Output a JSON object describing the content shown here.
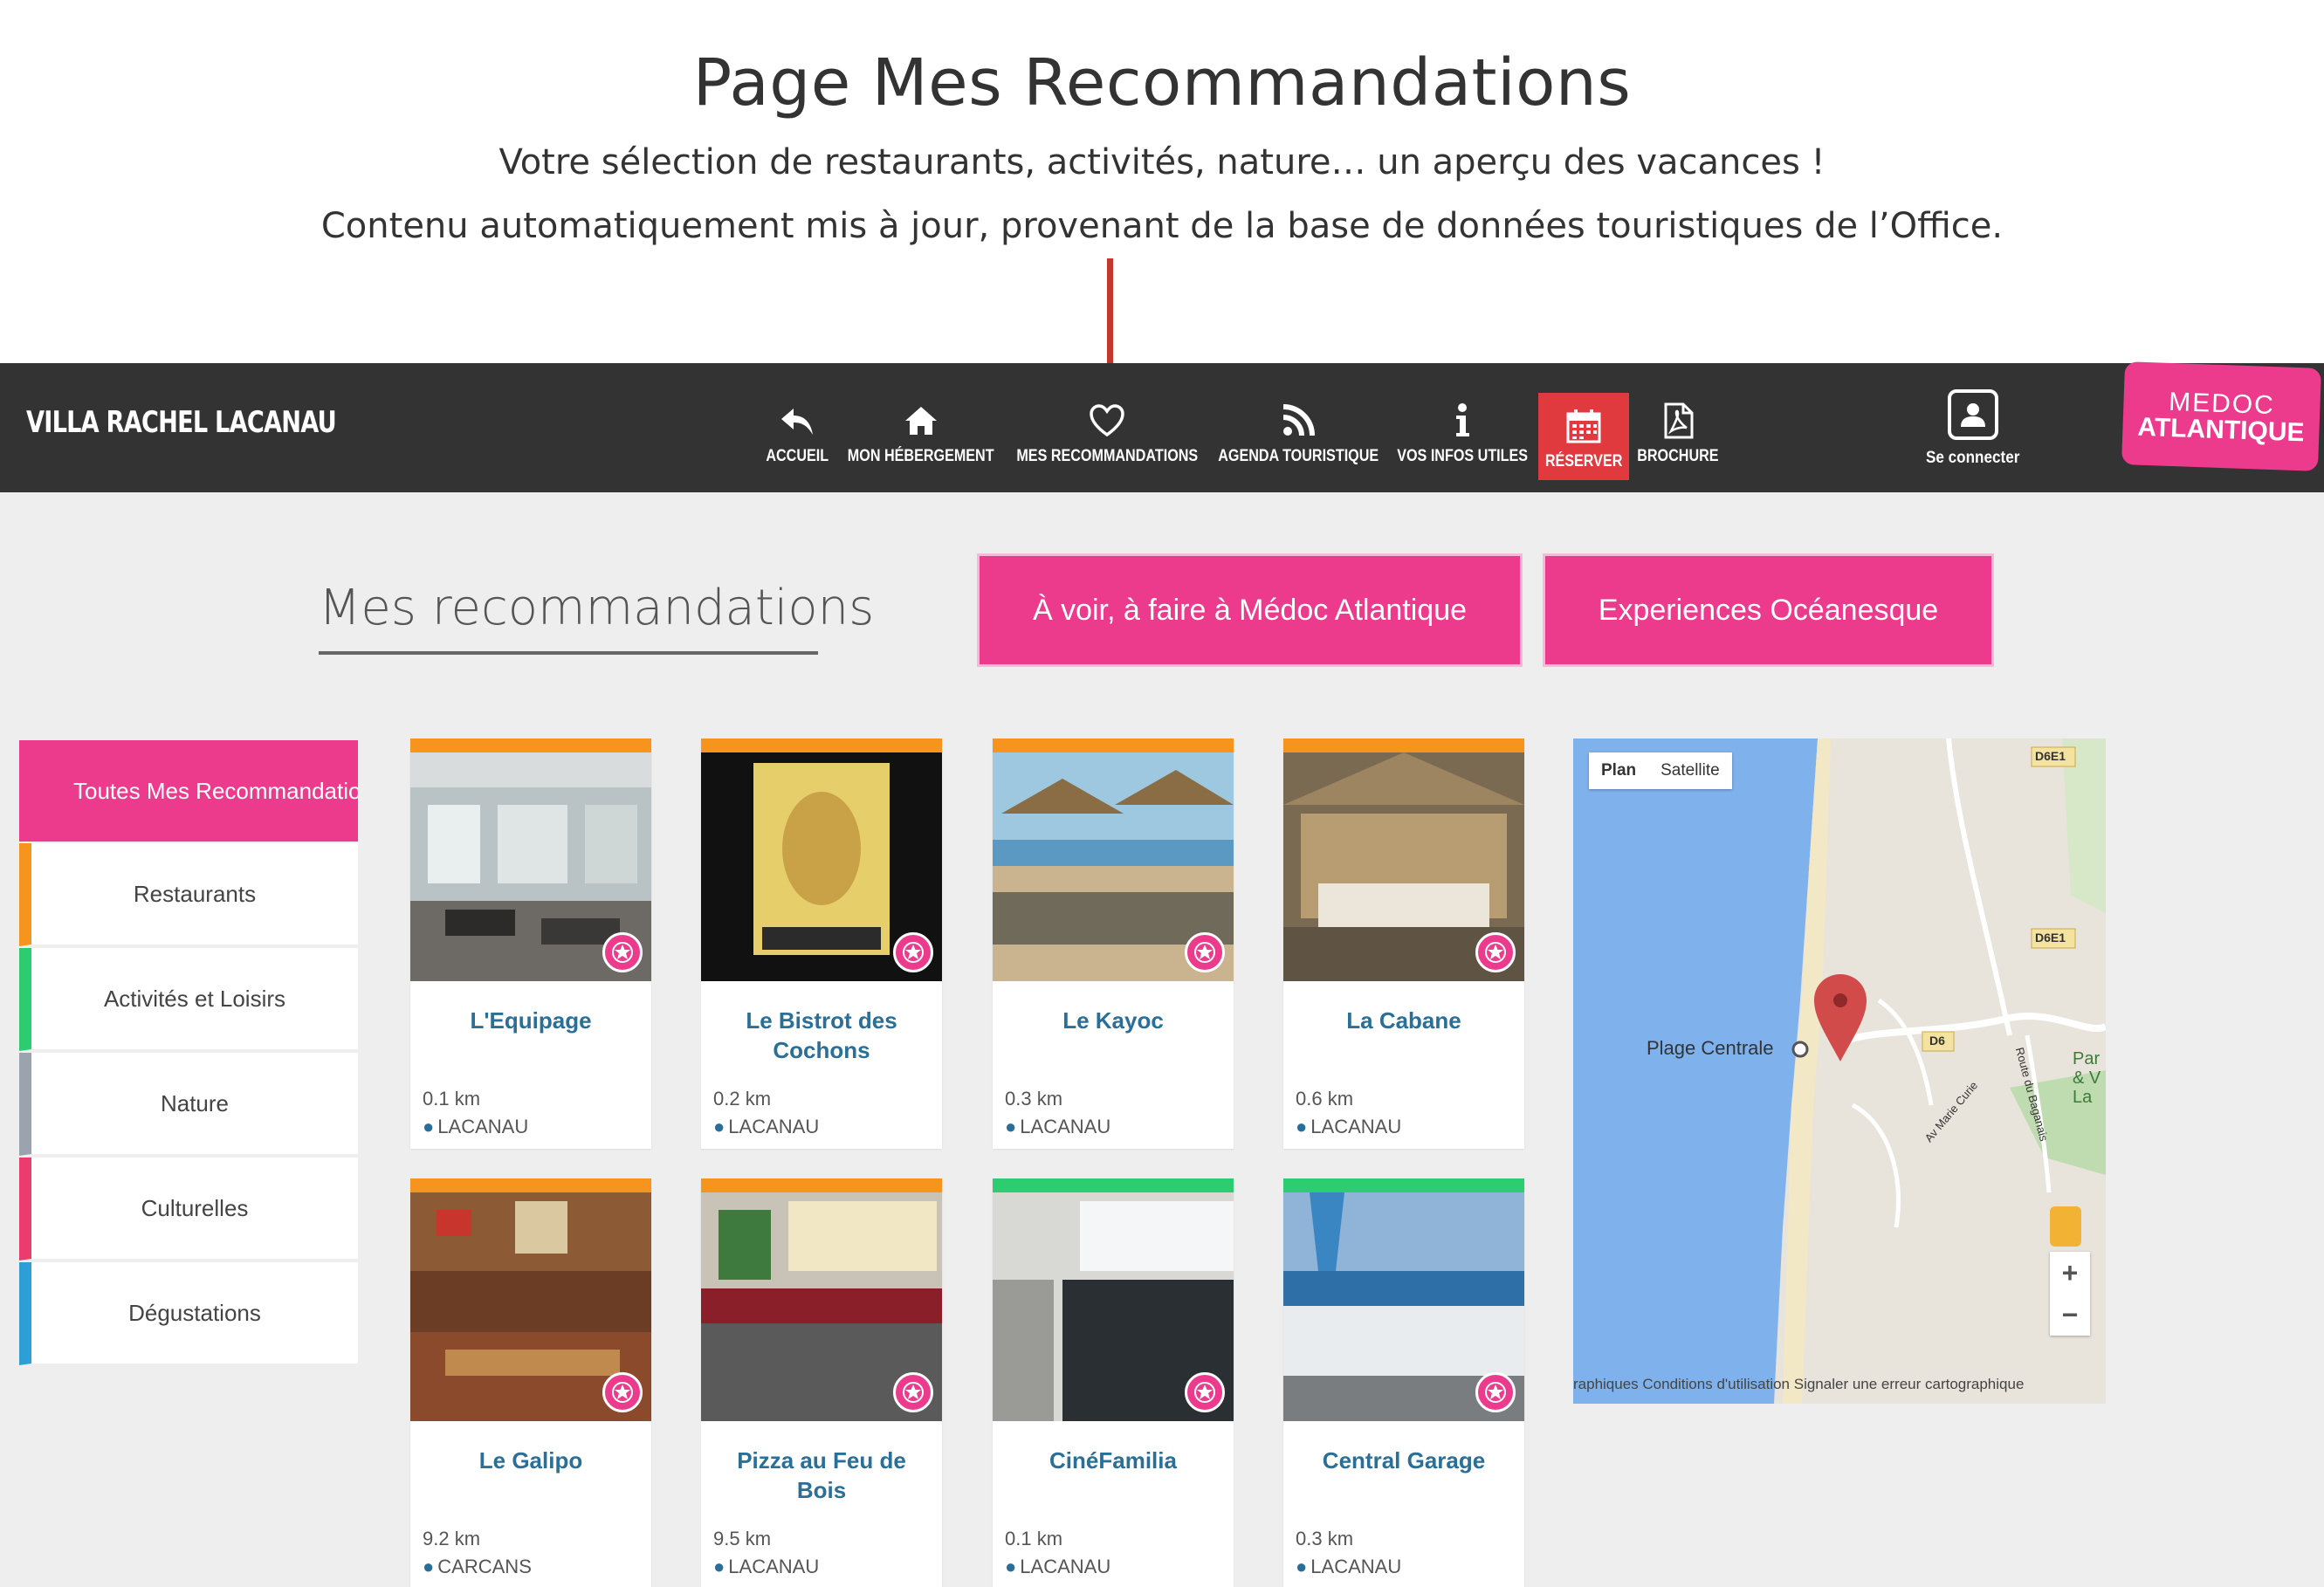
{
  "annotation": {
    "title": "Page Mes Recommandations",
    "line1": "Votre sélection de restaurants, activités, nature… un aperçu des vacances !",
    "line2": "Contenu automatiquement mis à jour, provenant de la base de données touristiques de l’Office."
  },
  "navbar": {
    "brand": "VILLA RACHEL LACANAU",
    "items": [
      {
        "label": "ACCUEIL",
        "icon": "reply-icon"
      },
      {
        "label": "MON HÉBERGEMENT",
        "icon": "home-icon"
      },
      {
        "label": "MES RECOMMANDATIONS",
        "icon": "heart-icon"
      },
      {
        "label": "AGENDA TOURISTIQUE",
        "icon": "rss-icon"
      },
      {
        "label": "VOS INFOS UTILES",
        "icon": "info-icon"
      },
      {
        "label": "RÉSERVER",
        "icon": "calendar-icon"
      },
      {
        "label": "BROCHURE",
        "icon": "pdf-icon"
      }
    ],
    "login": "Se connecter",
    "logo_line1": "MEDOC",
    "logo_line2": "ATLANTIQUE",
    "reserve_color": "#e03a3e"
  },
  "main": {
    "heading": "Mes recommandations",
    "button1": "À voir, à faire à Médoc Atlantique",
    "button2": "Experiences Océanesque",
    "accent": "#ec3b8d"
  },
  "filters": {
    "active": "Toutes Mes Recommandations",
    "items": [
      {
        "label": "Restaurants",
        "color": "#f7941d"
      },
      {
        "label": "Activités et Loisirs",
        "color": "#2ecc71"
      },
      {
        "label": "Nature",
        "color": "#9ba3ae"
      },
      {
        "label": "Culturelles",
        "color": "#ec3b6d"
      },
      {
        "label": "Dégustations",
        "color": "#2e9fd6"
      }
    ]
  },
  "cards": [
    {
      "name": "L'Equipage",
      "dist": "0.1 km",
      "town": "LACANAU",
      "color": "#f7941d"
    },
    {
      "name": "Le Bistrot des Cochons",
      "dist": "0.2 km",
      "town": "LACANAU",
      "color": "#f7941d"
    },
    {
      "name": "Le Kayoc",
      "dist": "0.3 km",
      "town": "LACANAU",
      "color": "#f7941d"
    },
    {
      "name": "La Cabane",
      "dist": "0.6 km",
      "town": "LACANAU",
      "color": "#f7941d"
    },
    {
      "name": "Le Galipo",
      "dist": "9.2 km",
      "town": "CARCANS",
      "color": "#f7941d"
    },
    {
      "name": "Pizza au Feu de Bois",
      "dist": "9.5 km",
      "town": "LACANAU",
      "color": "#f7941d"
    },
    {
      "name": "CinéFamilia",
      "dist": "0.1 km",
      "town": "LACANAU",
      "color": "#2ecc71"
    },
    {
      "name": "Central Garage",
      "dist": "0.3 km",
      "town": "LACANAU",
      "color": "#2ecc71"
    }
  ],
  "map": {
    "plan": "Plan",
    "satellite": "Satellite",
    "place": "Plage Centrale",
    "road1": "D6E1",
    "road2": "D6E1",
    "road3": "D6",
    "street1": "Av Marie Curie",
    "street2": "Route du Baganais",
    "park": "Par & V La",
    "zoom_in": "+",
    "zoom_out": "−",
    "attribution": "raphiques   Conditions d'utilisation    Signaler une erreur cartographique"
  }
}
